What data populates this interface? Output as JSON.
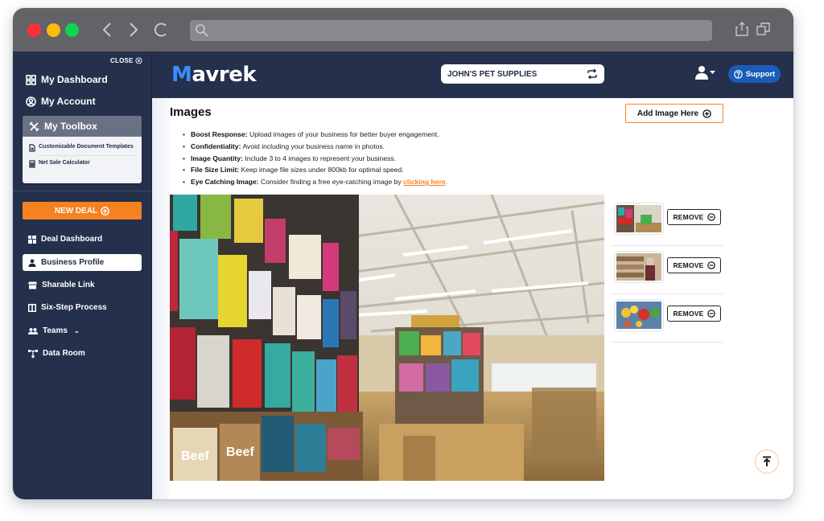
{
  "browser": {
    "url": "",
    "icons": [
      "back-icon",
      "forward-icon",
      "reload-icon",
      "search-icon",
      "share-icon",
      "tabs-icon"
    ]
  },
  "sidebar": {
    "close_label": "CLOSE",
    "top_items": [
      {
        "label": "My Dashboard",
        "icon": "dashboard-grid-icon"
      },
      {
        "label": "My Account",
        "icon": "account-circle-icon"
      }
    ],
    "toolbox": {
      "label": "My Toolbox",
      "icon": "tools-icon",
      "items": [
        {
          "label": "Customizable Document Templates",
          "icon": "document-icon"
        },
        {
          "label": "Net Sale Calculator",
          "icon": "calculator-icon"
        }
      ]
    },
    "new_deal_label": "NEW DEAL",
    "items": [
      {
        "label": "Deal Dashboard",
        "icon": "dashboard-icon",
        "active": false
      },
      {
        "label": "Business Profile",
        "icon": "user-icon",
        "active": true
      },
      {
        "label": "Sharable Link",
        "icon": "store-icon",
        "active": false
      },
      {
        "label": "Six-Step Process",
        "icon": "steps-icon",
        "active": false
      },
      {
        "label": "Teams",
        "icon": "team-icon",
        "active": false,
        "expandable": true
      },
      {
        "label": "Data Room",
        "icon": "data-room-icon",
        "active": false
      }
    ]
  },
  "header": {
    "logo_first": "M",
    "logo_rest": "avrek",
    "store_name": "JOHN'S PET SUPPLIES",
    "support_label": "Support"
  },
  "main": {
    "title": "Images",
    "add_image_label": "Add Image Here",
    "tips": [
      {
        "bold": "Boost Response:",
        "text": " Upload images of your business for better buyer engagement."
      },
      {
        "bold": "Confidentiality:",
        "text": " Avoid including your business name in photos."
      },
      {
        "bold": "Image Quantity:",
        "text": " Include 3 to 4 images to represent your business."
      },
      {
        "bold": "File Size Limit:",
        "text": " Keep image file sizes under 800kb for optimal speed."
      },
      {
        "bold": "Eye Catching Image:",
        "text": " Consider finding a free eye-catching image by ",
        "link": "clicking here",
        "after": "."
      }
    ],
    "main_image_alt": "Pet supply store interior with treat bags on shelves",
    "thumbnails": [
      {
        "alt": "Store aisle",
        "remove_label": "REMOVE"
      },
      {
        "alt": "Shopkeeper in store",
        "remove_label": "REMOVE"
      },
      {
        "alt": "Colorful pet toys",
        "remove_label": "REMOVE"
      }
    ]
  },
  "colors": {
    "navy": "#25304d",
    "accent_orange": "#f58220",
    "support_blue": "#1a5cb8",
    "logo_blue": "#3a8dff"
  }
}
